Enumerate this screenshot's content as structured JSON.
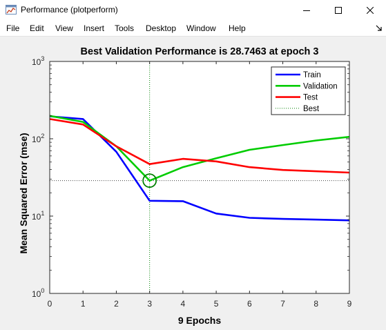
{
  "window": {
    "title": "Performance (plotperform)",
    "controls": {
      "minimize": "minimize",
      "maximize": "maximize",
      "close": "close"
    }
  },
  "menu": {
    "items": [
      "File",
      "Edit",
      "View",
      "Insert",
      "Tools",
      "Desktop",
      "Window",
      "Help"
    ]
  },
  "colors": {
    "train": "#0000ff",
    "validation": "#00cc00",
    "test": "#ff0000",
    "best": "#008000",
    "goal_line": "#404040",
    "figure_bg": "#f0f0f0",
    "axes_bg": "#ffffff"
  },
  "chart_data": {
    "type": "line",
    "title": "Best Validation Performance is 28.7463 at epoch 3",
    "xlabel": "9 Epochs",
    "ylabel": "Mean Squared Error  (mse)",
    "xlim": [
      0,
      9
    ],
    "ylim": [
      1,
      1000
    ],
    "yscale": "log",
    "xticks": [
      0,
      1,
      2,
      3,
      4,
      5,
      6,
      7,
      8,
      9
    ],
    "yticks": [
      {
        "value": 1,
        "base": "10",
        "exp": "0"
      },
      {
        "value": 10,
        "base": "10",
        "exp": "1"
      },
      {
        "value": 100,
        "base": "10",
        "exp": "2"
      },
      {
        "value": 1000,
        "base": "10",
        "exp": "3"
      }
    ],
    "x": [
      0,
      1,
      2,
      3,
      4,
      5,
      6,
      7,
      8,
      9
    ],
    "series": [
      {
        "name": "Train",
        "color": "#0000ff",
        "values": [
          195,
          180,
          68,
          15.8,
          15.6,
          10.8,
          9.5,
          9.2,
          9.0,
          8.8
        ]
      },
      {
        "name": "Validation",
        "color": "#00cc00",
        "values": [
          198,
          165,
          80,
          28.7,
          43,
          56,
          72,
          83,
          95,
          106
        ]
      },
      {
        "name": "Test",
        "color": "#ff0000",
        "values": [
          180,
          153,
          80,
          47,
          55,
          51,
          43,
          39.5,
          38,
          36.5
        ]
      }
    ],
    "best": {
      "name": "Best",
      "epoch": 3,
      "value": 28.7463,
      "color": "#008000"
    },
    "grid": false,
    "legend_position": "top-right"
  }
}
